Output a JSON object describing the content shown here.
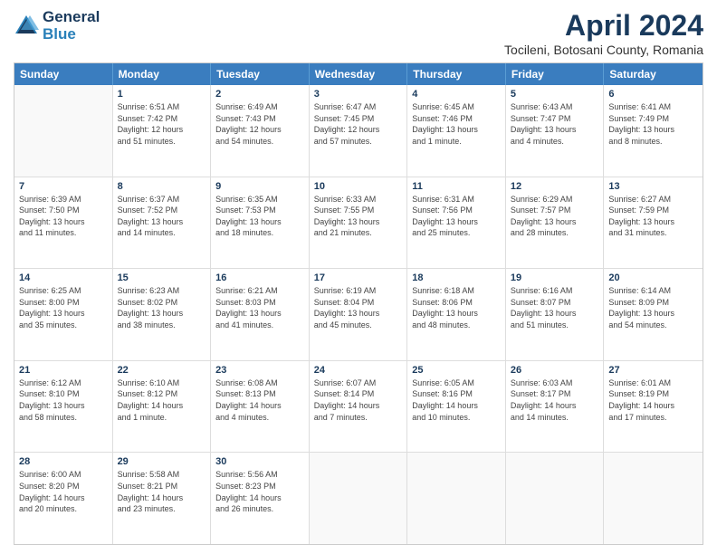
{
  "header": {
    "logo_line1": "General",
    "logo_line2": "Blue",
    "title": "April 2024",
    "subtitle": "Tocileni, Botosani County, Romania"
  },
  "days_of_week": [
    "Sunday",
    "Monday",
    "Tuesday",
    "Wednesday",
    "Thursday",
    "Friday",
    "Saturday"
  ],
  "weeks": [
    [
      {
        "day": "",
        "info": ""
      },
      {
        "day": "1",
        "info": "Sunrise: 6:51 AM\nSunset: 7:42 PM\nDaylight: 12 hours\nand 51 minutes."
      },
      {
        "day": "2",
        "info": "Sunrise: 6:49 AM\nSunset: 7:43 PM\nDaylight: 12 hours\nand 54 minutes."
      },
      {
        "day": "3",
        "info": "Sunrise: 6:47 AM\nSunset: 7:45 PM\nDaylight: 12 hours\nand 57 minutes."
      },
      {
        "day": "4",
        "info": "Sunrise: 6:45 AM\nSunset: 7:46 PM\nDaylight: 13 hours\nand 1 minute."
      },
      {
        "day": "5",
        "info": "Sunrise: 6:43 AM\nSunset: 7:47 PM\nDaylight: 13 hours\nand 4 minutes."
      },
      {
        "day": "6",
        "info": "Sunrise: 6:41 AM\nSunset: 7:49 PM\nDaylight: 13 hours\nand 8 minutes."
      }
    ],
    [
      {
        "day": "7",
        "info": "Sunrise: 6:39 AM\nSunset: 7:50 PM\nDaylight: 13 hours\nand 11 minutes."
      },
      {
        "day": "8",
        "info": "Sunrise: 6:37 AM\nSunset: 7:52 PM\nDaylight: 13 hours\nand 14 minutes."
      },
      {
        "day": "9",
        "info": "Sunrise: 6:35 AM\nSunset: 7:53 PM\nDaylight: 13 hours\nand 18 minutes."
      },
      {
        "day": "10",
        "info": "Sunrise: 6:33 AM\nSunset: 7:55 PM\nDaylight: 13 hours\nand 21 minutes."
      },
      {
        "day": "11",
        "info": "Sunrise: 6:31 AM\nSunset: 7:56 PM\nDaylight: 13 hours\nand 25 minutes."
      },
      {
        "day": "12",
        "info": "Sunrise: 6:29 AM\nSunset: 7:57 PM\nDaylight: 13 hours\nand 28 minutes."
      },
      {
        "day": "13",
        "info": "Sunrise: 6:27 AM\nSunset: 7:59 PM\nDaylight: 13 hours\nand 31 minutes."
      }
    ],
    [
      {
        "day": "14",
        "info": "Sunrise: 6:25 AM\nSunset: 8:00 PM\nDaylight: 13 hours\nand 35 minutes."
      },
      {
        "day": "15",
        "info": "Sunrise: 6:23 AM\nSunset: 8:02 PM\nDaylight: 13 hours\nand 38 minutes."
      },
      {
        "day": "16",
        "info": "Sunrise: 6:21 AM\nSunset: 8:03 PM\nDaylight: 13 hours\nand 41 minutes."
      },
      {
        "day": "17",
        "info": "Sunrise: 6:19 AM\nSunset: 8:04 PM\nDaylight: 13 hours\nand 45 minutes."
      },
      {
        "day": "18",
        "info": "Sunrise: 6:18 AM\nSunset: 8:06 PM\nDaylight: 13 hours\nand 48 minutes."
      },
      {
        "day": "19",
        "info": "Sunrise: 6:16 AM\nSunset: 8:07 PM\nDaylight: 13 hours\nand 51 minutes."
      },
      {
        "day": "20",
        "info": "Sunrise: 6:14 AM\nSunset: 8:09 PM\nDaylight: 13 hours\nand 54 minutes."
      }
    ],
    [
      {
        "day": "21",
        "info": "Sunrise: 6:12 AM\nSunset: 8:10 PM\nDaylight: 13 hours\nand 58 minutes."
      },
      {
        "day": "22",
        "info": "Sunrise: 6:10 AM\nSunset: 8:12 PM\nDaylight: 14 hours\nand 1 minute."
      },
      {
        "day": "23",
        "info": "Sunrise: 6:08 AM\nSunset: 8:13 PM\nDaylight: 14 hours\nand 4 minutes."
      },
      {
        "day": "24",
        "info": "Sunrise: 6:07 AM\nSunset: 8:14 PM\nDaylight: 14 hours\nand 7 minutes."
      },
      {
        "day": "25",
        "info": "Sunrise: 6:05 AM\nSunset: 8:16 PM\nDaylight: 14 hours\nand 10 minutes."
      },
      {
        "day": "26",
        "info": "Sunrise: 6:03 AM\nSunset: 8:17 PM\nDaylight: 14 hours\nand 14 minutes."
      },
      {
        "day": "27",
        "info": "Sunrise: 6:01 AM\nSunset: 8:19 PM\nDaylight: 14 hours\nand 17 minutes."
      }
    ],
    [
      {
        "day": "28",
        "info": "Sunrise: 6:00 AM\nSunset: 8:20 PM\nDaylight: 14 hours\nand 20 minutes."
      },
      {
        "day": "29",
        "info": "Sunrise: 5:58 AM\nSunset: 8:21 PM\nDaylight: 14 hours\nand 23 minutes."
      },
      {
        "day": "30",
        "info": "Sunrise: 5:56 AM\nSunset: 8:23 PM\nDaylight: 14 hours\nand 26 minutes."
      },
      {
        "day": "",
        "info": ""
      },
      {
        "day": "",
        "info": ""
      },
      {
        "day": "",
        "info": ""
      },
      {
        "day": "",
        "info": ""
      }
    ]
  ]
}
